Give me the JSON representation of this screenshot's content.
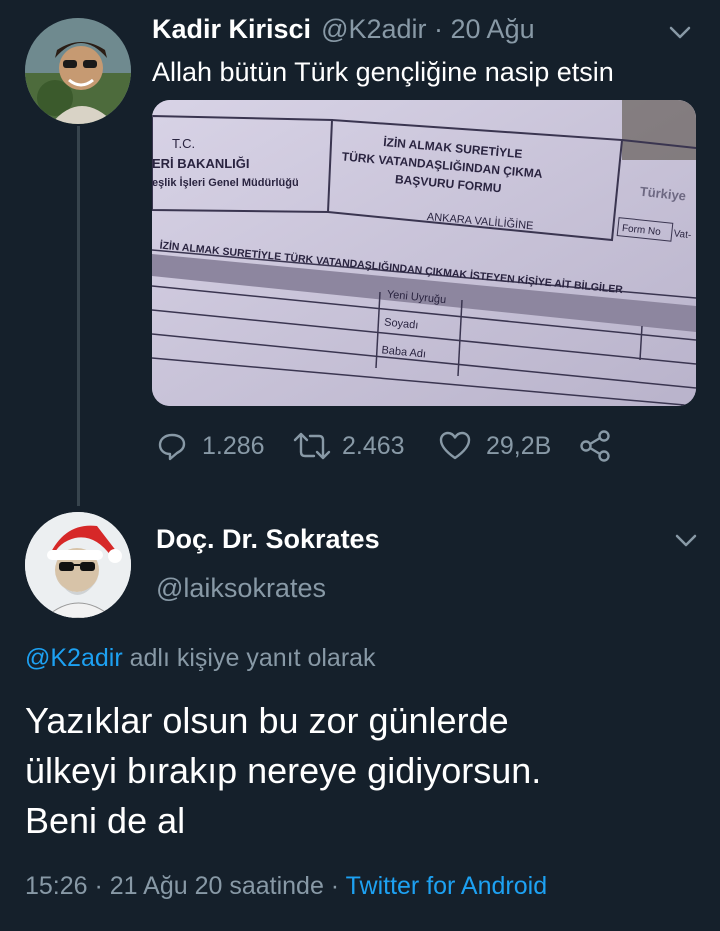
{
  "tweet": {
    "name": "Kadir Kirisci",
    "handle_time": "@K2adir · 20 Ağu",
    "text": "Allah bütün Türk gençliğine nasip etsin",
    "media": {
      "tc": "T.C.",
      "ministry": "ERİ BAKANLIĞI",
      "directorate": "eşlik İşleri Genel Müdürlüğü",
      "form_title_1": "İZİN ALMAK SURETİYLE",
      "form_title_2": "TÜRK VATANDAŞLIĞINDAN ÇIKMA",
      "form_title_3": "BAŞVURU FORMU",
      "logo": "Türkiye",
      "form_no": "Form No",
      "form_no_2": "Vat-",
      "ankara": "ANKARA VALİLİĞİNE",
      "section": "İZİN ALMAK SURETİYLE TÜRK VATANDAŞLIĞINDAN ÇIKMAK İSTEYEN KİŞİYE AİT BİLGİLER",
      "row1": "Yeni Uyruğu",
      "row2": "Soyadı",
      "row3": "Baba Adı"
    },
    "replies": "1.286",
    "retweets": "2.463",
    "likes": "29,2B"
  },
  "reply": {
    "name": "Doç. Dr. Sokrates",
    "handle": "@laiksokrates",
    "reply_to_user": "@K2adir",
    "reply_to_suffix": " adlı kişiye yanıt olarak",
    "line1": "Yazıklar olsun bu zor günlerde",
    "line2": "ülkeyi bırakıp nereye gidiyorsun.",
    "line3": "Beni de al",
    "timestamp": "15:26 · 21 Ağu 20 saatinde · ",
    "source": "Twitter for Android"
  },
  "colors": {
    "background": "#15202b",
    "muted": "#8899a6",
    "link": "#1da1f2",
    "thread_line": "#37444d"
  },
  "icons": [
    "chevron-down-icon",
    "reply-icon",
    "retweet-icon",
    "like-icon",
    "share-icon"
  ]
}
